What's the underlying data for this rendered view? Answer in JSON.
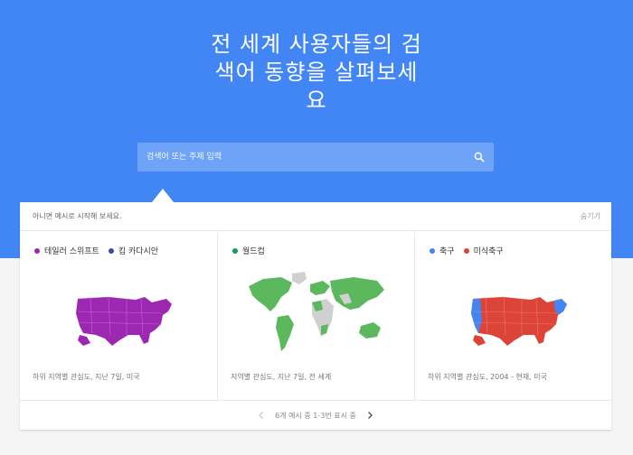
{
  "hero": {
    "headline_line1": "전 세계 사용자들의 검",
    "headline_line2": "색어 동향을 살펴보세",
    "headline_line3": "요",
    "background": "#4285f4"
  },
  "search": {
    "placeholder": "검색어 또는 주제 입력",
    "icon": "search-icon"
  },
  "examples": {
    "intro": "아니면 예시로 시작해 보세요.",
    "hide_label": "숨기기",
    "cards": [
      {
        "legend": [
          {
            "label": "테일러 스위프트",
            "color": "#9c27b0"
          },
          {
            "label": "킴 카다시안",
            "color": "#3949ab"
          }
        ],
        "map": "us-map",
        "caption": "하위 지역별 관심도, 지난 7일, 미국"
      },
      {
        "legend": [
          {
            "label": "월드컵",
            "color": "#0f9d58"
          }
        ],
        "map": "world-map",
        "caption": "지역별 관심도, 지난 7일, 전 세계"
      },
      {
        "legend": [
          {
            "label": "축구",
            "color": "#4285f4"
          },
          {
            "label": "미식축구",
            "color": "#db4437"
          }
        ],
        "map": "us-map",
        "caption": "하위 지역별 관심도, 2004 - 현재, 미국"
      }
    ],
    "pagination": "6개 예시 중 1-3번 표시 중"
  }
}
